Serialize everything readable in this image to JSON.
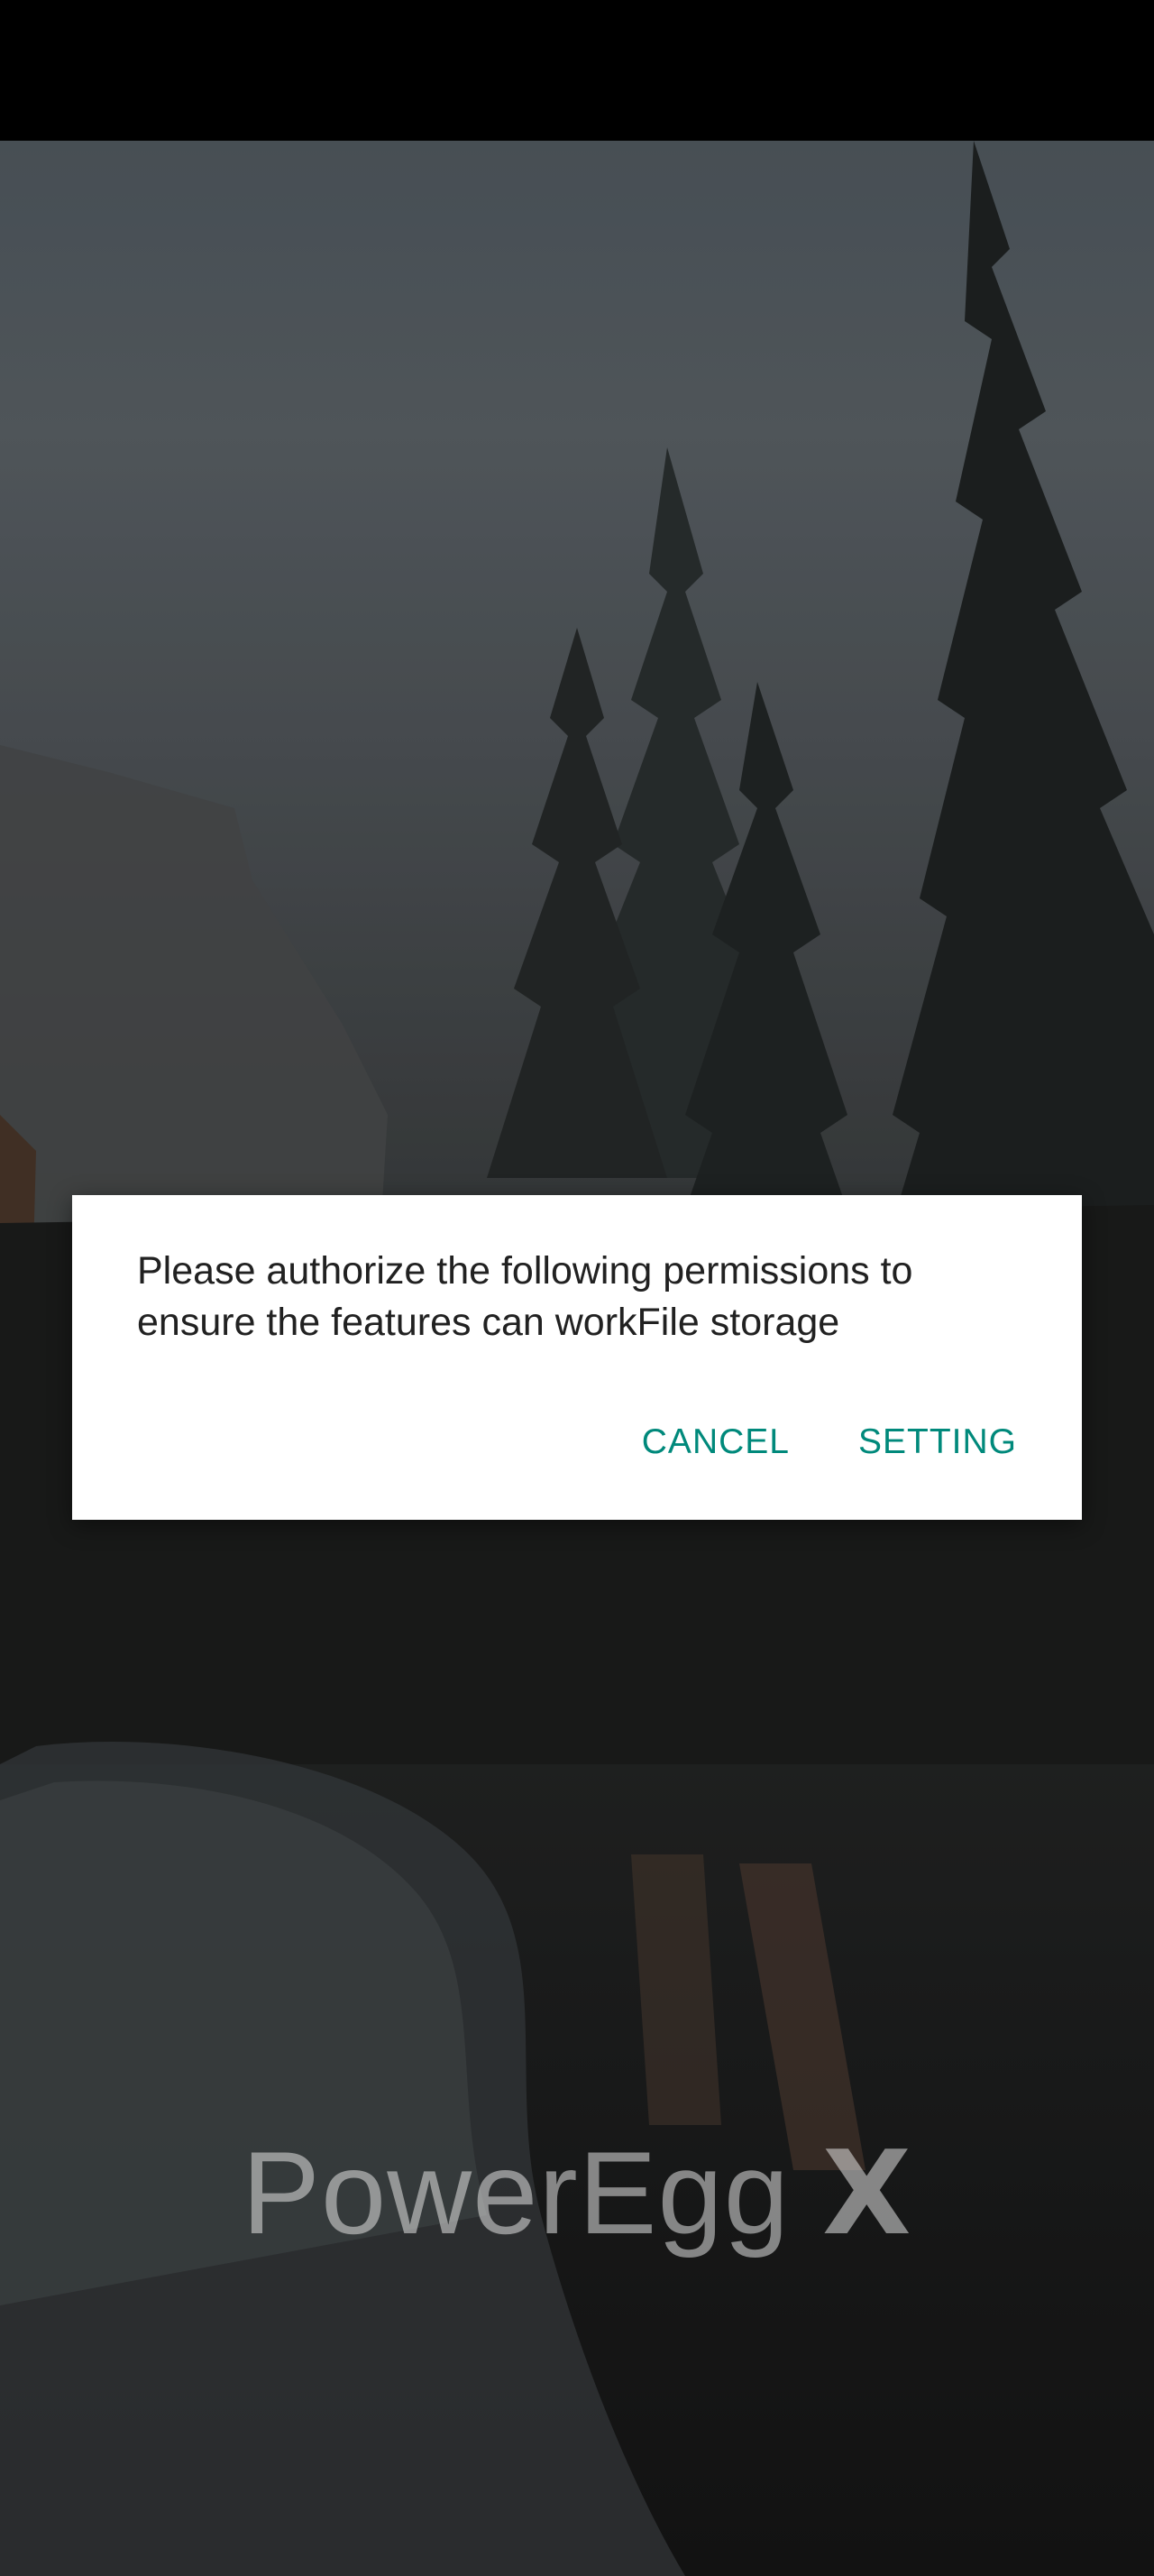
{
  "app": {
    "logo_text": "PowerEgg",
    "logo_mark": "X"
  },
  "permission_dialog": {
    "message": "Please authorize the following permissions to ensure the features can workFile storage",
    "cancel_label": "CANCEL",
    "setting_label": "SETTING",
    "accent_color": "#00897b"
  },
  "background": {
    "description_icon": "landscape-photo"
  }
}
